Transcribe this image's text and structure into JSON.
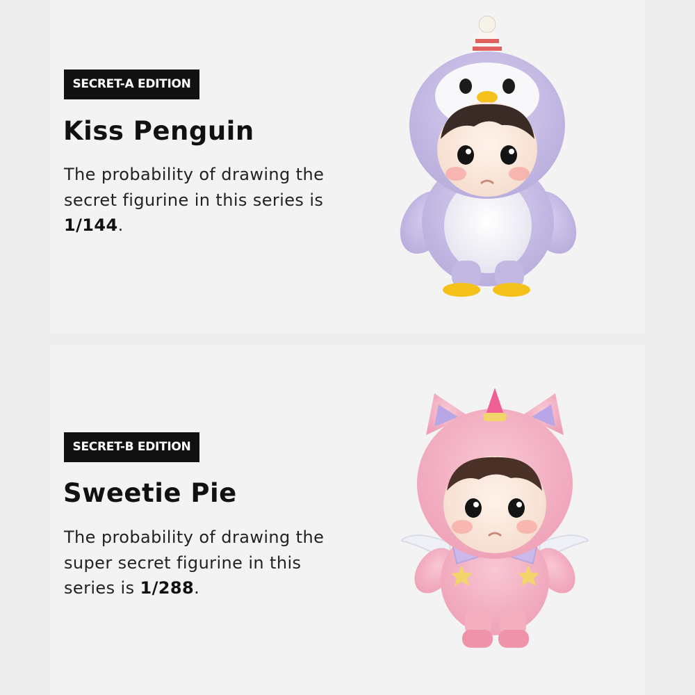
{
  "sections": [
    {
      "badge": "SECRET-A EDITION",
      "title": "Kiss Penguin",
      "description_text": "The probability of drawing the secret figurine in this series is",
      "probability": "1/144",
      "suffix": ".",
      "figure_colors": {
        "fur": "#c9bfe6",
        "belly": "#f1f0f6",
        "feet": "#f4c21b",
        "hat_stripe": "#e0605f"
      }
    },
    {
      "badge": "SECRET-B EDITION",
      "title": "Sweetie Pie",
      "description_text": "The probability of drawing the super secret figurine in this series is",
      "probability": "1/288",
      "suffix": ".",
      "figure_colors": {
        "fur": "#f4b3c5",
        "collar": "#cbb9ec",
        "stars": "#f1d56a",
        "horn": "#ef5f93"
      }
    }
  ],
  "colors": {
    "page_background": "#ececec",
    "panel_background": "#f3f3f3",
    "badge_background": "#111111",
    "badge_text": "#ffffff",
    "title_text": "#111111"
  }
}
